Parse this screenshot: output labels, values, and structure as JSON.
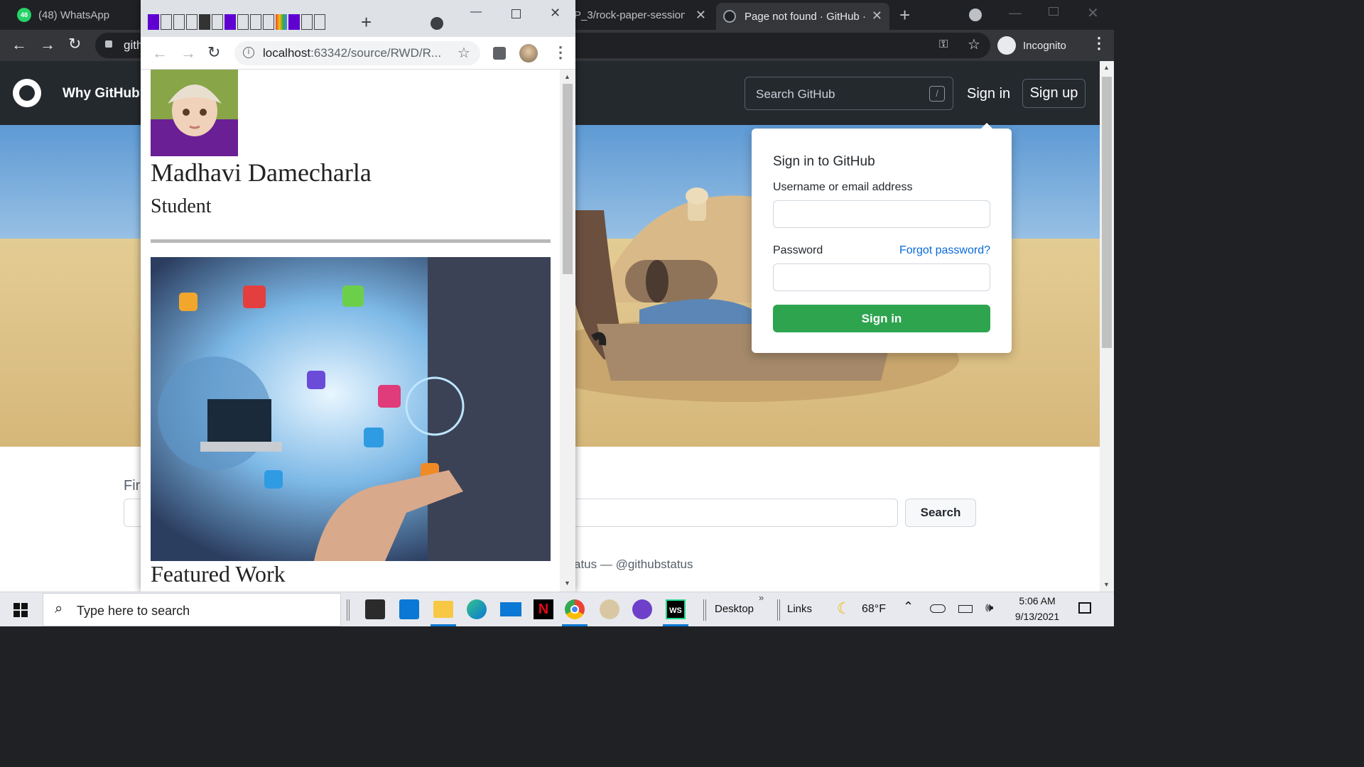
{
  "back_browser": {
    "tabs": [
      {
        "title": "(48) WhatsApp",
        "badge": "48"
      },
      {
        "title": "P_3/rock-paper-session"
      },
      {
        "title": "Page not found · GitHub ·"
      }
    ],
    "address_partial": "gith",
    "incognito_label": "Incognito"
  },
  "github": {
    "nav_why": "Why GitHub?",
    "search_placeholder": "Search GitHub",
    "search_shortcut": "/",
    "signin_link": "Sign in",
    "signup_link": "Sign up",
    "signin_card": {
      "heading": "Sign in to GitHub",
      "username_label": "Username or email address",
      "password_label": "Password",
      "forgot": "Forgot password?",
      "submit": "Sign in"
    },
    "find_label_partial": "Fir",
    "search_button": "Search",
    "status_text": "atus — @githubstatus"
  },
  "popup": {
    "address_host": "localhost",
    "address_path": ":63342/source/RWD/R...",
    "name": "Madhavi Damecharla",
    "role": "Student",
    "featured": "Featured Work"
  },
  "taskbar": {
    "search_placeholder": "Type here to search",
    "desktop": "Desktop",
    "links": "Links",
    "temp": "68°F",
    "time": "5:06 AM",
    "date": "9/13/2021"
  }
}
